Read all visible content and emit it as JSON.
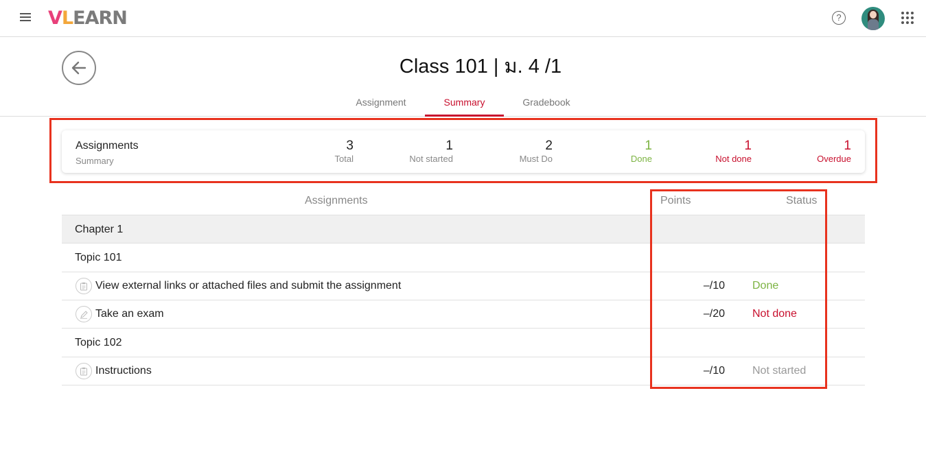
{
  "app": {
    "logo": [
      "V",
      "L",
      "EARN"
    ]
  },
  "header": {
    "title": "Class 101 | ม. 4 /1"
  },
  "tabs": [
    {
      "label": "Assignment",
      "active": false
    },
    {
      "label": "Summary",
      "active": true
    },
    {
      "label": "Gradebook",
      "active": false
    }
  ],
  "summary": {
    "title": "Assignments",
    "subtitle": "Summary",
    "stats": [
      {
        "value": "3",
        "label": "Total",
        "color": "#222222"
      },
      {
        "value": "1",
        "label": "Not started",
        "color": "#222222"
      },
      {
        "value": "2",
        "label": "Must Do",
        "color": "#222222"
      },
      {
        "value": "1",
        "label": "Done",
        "color": "#7cb342"
      },
      {
        "value": "1",
        "label": "Not done",
        "color": "#c8102e"
      },
      {
        "value": "1",
        "label": "Overdue",
        "color": "#c8102e"
      }
    ]
  },
  "table": {
    "columns": {
      "assignments": "Assignments",
      "points": "Points",
      "status": "Status"
    },
    "chapter": "Chapter 1",
    "topics": [
      "Topic 101",
      "Topic 102"
    ],
    "assignments": [
      {
        "title": "View external links or attached files and submit the assignment",
        "icon": "clipboard-icon",
        "points": "–/10",
        "status": "Done",
        "status_color": "#7cb342"
      },
      {
        "title": "Take an exam",
        "icon": "pencil-icon",
        "points": "–/20",
        "status": "Not done",
        "status_color": "#c8102e"
      },
      {
        "title": "Instructions",
        "icon": "clipboard-icon",
        "points": "–/10",
        "status": "Not started",
        "status_color": "#999999"
      }
    ]
  },
  "colors": {
    "accent": "#c8102e",
    "highlight": "#e8321e"
  }
}
